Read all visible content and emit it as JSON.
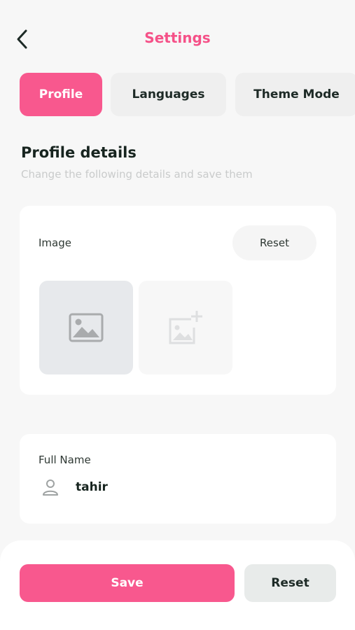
{
  "header": {
    "title": "Settings"
  },
  "tabs": [
    {
      "label": "Profile",
      "active": true
    },
    {
      "label": "Languages",
      "active": false
    },
    {
      "label": "Theme Mode",
      "active": false
    }
  ],
  "section": {
    "title": "Profile details",
    "subtitle": "Change the following details and save them"
  },
  "image_card": {
    "label": "Image",
    "reset_label": "Reset",
    "placeholder_icon": "image-icon",
    "add_icon": "add-image-icon"
  },
  "name_card": {
    "label": "Full Name",
    "value": "tahir",
    "icon": "user-icon"
  },
  "actions": {
    "save_label": "Save",
    "reset_label": "Reset"
  },
  "colors": {
    "accent": "#f8588e",
    "title": "#f55188",
    "background": "#f7f7f7"
  }
}
